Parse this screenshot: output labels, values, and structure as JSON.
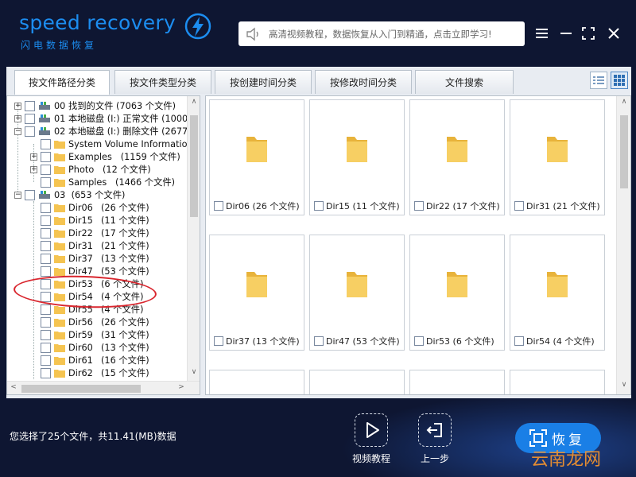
{
  "app": {
    "logo_text": "speed recovery",
    "logo_sub": "闪电数据恢复",
    "banner_text": "高清视频教程，数据恢复从入门到精通，点击立即学习!",
    "menu_icon": "hamburger-menu-icon",
    "minimize_icon": "minimize-icon",
    "maximize_icon": "maximize-icon",
    "close_icon": "close-icon"
  },
  "tabs": [
    {
      "label": "按文件路径分类",
      "active": true
    },
    {
      "label": "按文件类型分类",
      "active": false
    },
    {
      "label": "按创建时间分类",
      "active": false
    },
    {
      "label": "按修改时间分类",
      "active": false
    },
    {
      "label": "文件搜索",
      "active": false
    }
  ],
  "tree": [
    {
      "name": "00 找到的文件",
      "count": "(7063 个文件)"
    },
    {
      "name": "01 本地磁盘 (I:) 正常文件",
      "count": "(1000"
    },
    {
      "name": "02 本地磁盘 (I:) 删除文件",
      "count": "(2677"
    },
    {
      "name": "System Volume Information",
      "count": ""
    },
    {
      "name": "Examples",
      "count": "(1159 个文件)"
    },
    {
      "name": "Photo",
      "count": "(12 个文件)"
    },
    {
      "name": "Samples",
      "count": "(1466 个文件)"
    },
    {
      "name": "03",
      "count": "(653 个文件)"
    },
    {
      "name": "Dir06",
      "count": "(26 个文件)"
    },
    {
      "name": "Dir15",
      "count": "(11 个文件)"
    },
    {
      "name": "Dir22",
      "count": "(17 个文件)"
    },
    {
      "name": "Dir31",
      "count": "(21 个文件)"
    },
    {
      "name": "Dir37",
      "count": "(13 个文件)"
    },
    {
      "name": "Dir47",
      "count": "(53 个文件)"
    },
    {
      "name": "Dir53",
      "count": "(6 个文件)"
    },
    {
      "name": "Dir54",
      "count": "(4 个文件)"
    },
    {
      "name": "Dir55",
      "count": "(4 个文件)"
    },
    {
      "name": "Dir56",
      "count": "(26 个文件)"
    },
    {
      "name": "Dir59",
      "count": "(31 个文件)"
    },
    {
      "name": "Dir60",
      "count": "(13 个文件)"
    },
    {
      "name": "Dir61",
      "count": "(16 个文件)"
    },
    {
      "name": "Dir62",
      "count": "(15 个文件)"
    }
  ],
  "tiles": [
    {
      "label": "Dir06 (26 个文件)"
    },
    {
      "label": "Dir15 (11 个文件)"
    },
    {
      "label": "Dir22 (17 个文件)"
    },
    {
      "label": "Dir31 (21 个文件)"
    },
    {
      "label": "Dir37 (13 个文件)"
    },
    {
      "label": "Dir47 (53 个文件)"
    },
    {
      "label": "Dir53 (6 个文件)"
    },
    {
      "label": "Dir54 (4 个文件)"
    }
  ],
  "status": "您选择了25个文件，共11.41(MB)数据",
  "buttons": {
    "video": "视频教程",
    "back": "上一步",
    "recover": "恢复"
  },
  "watermark": "云南龙网",
  "colors": {
    "accent": "#1a7fe6",
    "background": "#0e1632",
    "highlight_circle": "#d9262e",
    "folder": "#f5c451"
  }
}
